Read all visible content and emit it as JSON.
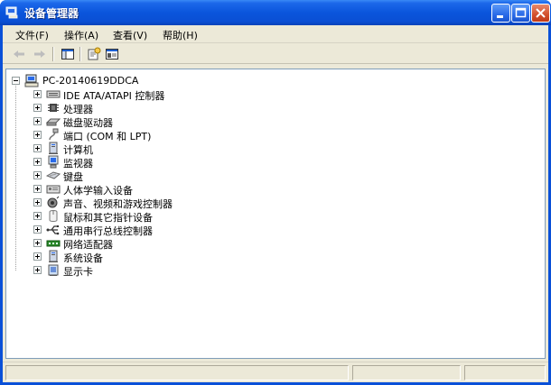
{
  "window": {
    "title": "设备管理器"
  },
  "menu": [
    {
      "label": "文件(F)"
    },
    {
      "label": "操作(A)"
    },
    {
      "label": "查看(V)"
    },
    {
      "label": "帮助(H)"
    }
  ],
  "tree": {
    "root": "PC-20140619DDCA",
    "nodes": [
      {
        "label": "IDE ATA/ATAPI 控制器",
        "icon": "ide-controller-icon"
      },
      {
        "label": "处理器",
        "icon": "processor-icon"
      },
      {
        "label": "磁盘驱动器",
        "icon": "disk-drive-icon"
      },
      {
        "label": "端口 (COM 和 LPT)",
        "icon": "port-icon"
      },
      {
        "label": "计算机",
        "icon": "computer-icon"
      },
      {
        "label": "监视器",
        "icon": "monitor-icon"
      },
      {
        "label": "键盘",
        "icon": "keyboard-icon"
      },
      {
        "label": "人体学输入设备",
        "icon": "hid-icon"
      },
      {
        "label": "声音、视频和游戏控制器",
        "icon": "sound-icon"
      },
      {
        "label": "鼠标和其它指针设备",
        "icon": "mouse-icon"
      },
      {
        "label": "通用串行总线控制器",
        "icon": "usb-icon"
      },
      {
        "label": "网络适配器",
        "icon": "network-adapter-icon"
      },
      {
        "label": "系统设备",
        "icon": "system-device-icon"
      },
      {
        "label": "显示卡",
        "icon": "display-adapter-icon"
      }
    ]
  },
  "colors": {
    "titlebar": "#0a55dc",
    "panel_border": "#7f9db9",
    "chrome": "#ece9d8"
  }
}
